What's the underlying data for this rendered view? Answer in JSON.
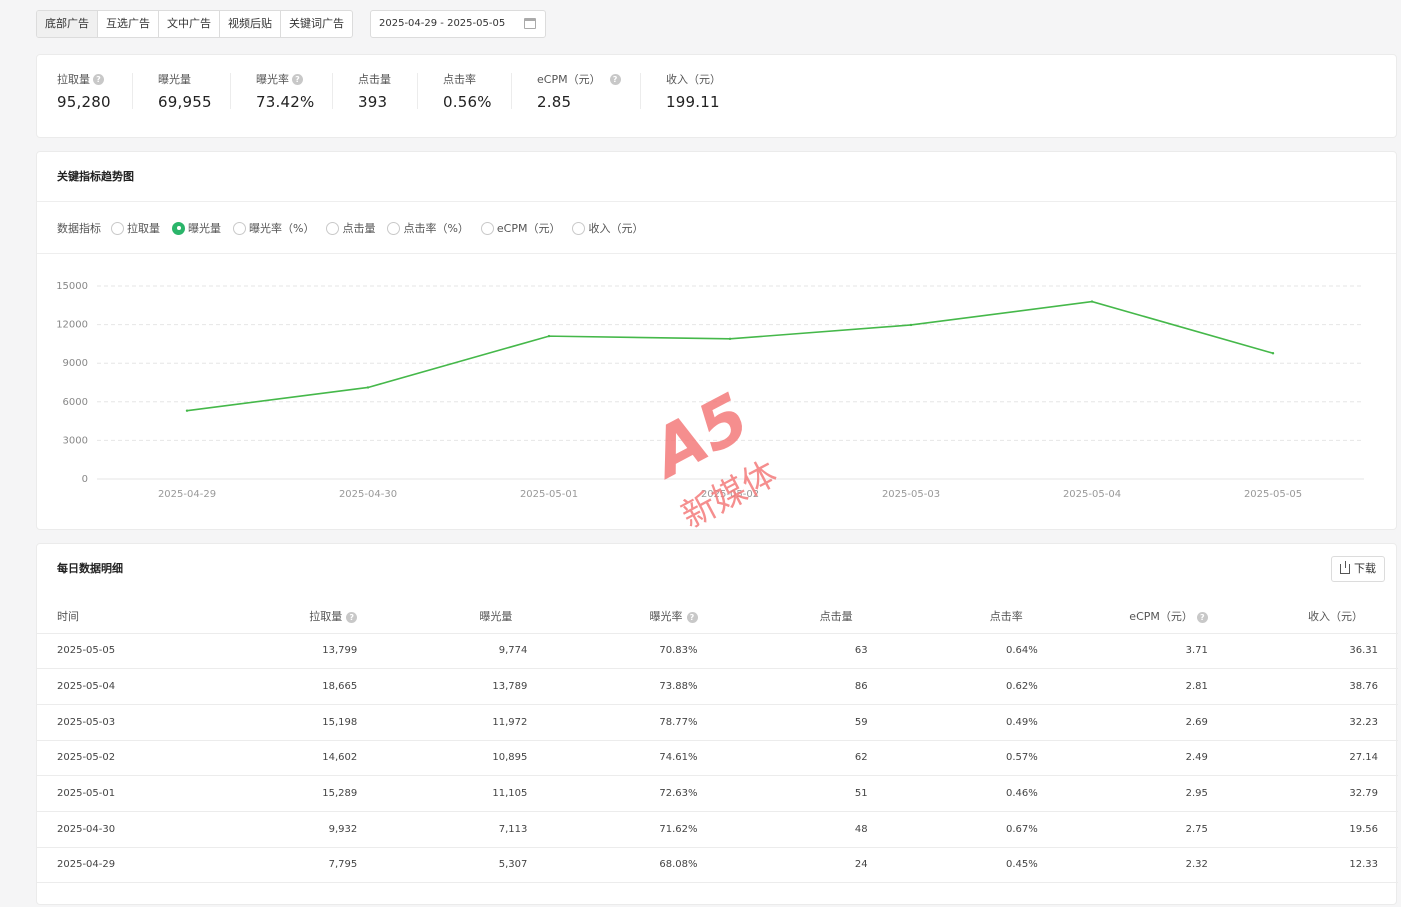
{
  "tabs": [
    "底部广告",
    "互选广告",
    "文中广告",
    "视频后贴",
    "关键词广告"
  ],
  "date_range": "2025-04-29 - 2025-05-05",
  "summary": [
    {
      "label": "拉取量",
      "value": "95,280",
      "help": true
    },
    {
      "label": "曝光量",
      "value": "69,955",
      "help": false
    },
    {
      "label": "曝光率",
      "value": "73.42%",
      "help": true
    },
    {
      "label": "点击量",
      "value": "393",
      "help": false
    },
    {
      "label": "点击率",
      "value": "0.56%",
      "help": false
    },
    {
      "label": "eCPM（元）",
      "value": "2.85",
      "help": true
    },
    {
      "label": "收入（元）",
      "value": "199.11",
      "help": false
    }
  ],
  "trend": {
    "title": "关键指标趋势图",
    "metric_label": "数据指标",
    "options": [
      "拉取量",
      "曝光量",
      "曝光率（%）",
      "点击量",
      "点击率（%）",
      "eCPM（元）",
      "收入（元）"
    ],
    "selected": "曝光量"
  },
  "chart_data": {
    "type": "line",
    "x": [
      "2025-04-29",
      "2025-04-30",
      "2025-05-01",
      "2025-05-02",
      "2025-05-03",
      "2025-05-04",
      "2025-05-05"
    ],
    "series": [
      {
        "values": [
          5307,
          7113,
          11105,
          10895,
          11972,
          13789,
          9774
        ],
        "color": "#45b84a"
      }
    ],
    "ylim": [
      0,
      15000
    ],
    "yticks": [
      0,
      3000,
      6000,
      9000,
      12000,
      15000
    ],
    "grid": true
  },
  "watermark": {
    "logo_text": "A5",
    "text": "新媒体",
    "color": "#f47b7b"
  },
  "detail": {
    "title": "每日数据明细",
    "download_label": "下载",
    "columns": [
      "时间",
      "拉取量",
      "曝光量",
      "曝光率",
      "点击量",
      "点击率",
      "eCPM（元）",
      "收入（元）"
    ],
    "help_columns": [
      1,
      3,
      6
    ],
    "rows": [
      [
        "2025-05-05",
        "13,799",
        "9,774",
        "70.83%",
        "63",
        "0.64%",
        "3.71",
        "36.31"
      ],
      [
        "2025-05-04",
        "18,665",
        "13,789",
        "73.88%",
        "86",
        "0.62%",
        "2.81",
        "38.76"
      ],
      [
        "2025-05-03",
        "15,198",
        "11,972",
        "78.77%",
        "59",
        "0.49%",
        "2.69",
        "32.23"
      ],
      [
        "2025-05-02",
        "14,602",
        "10,895",
        "74.61%",
        "62",
        "0.57%",
        "2.49",
        "27.14"
      ],
      [
        "2025-05-01",
        "15,289",
        "11,105",
        "72.63%",
        "51",
        "0.46%",
        "2.95",
        "32.79"
      ],
      [
        "2025-04-30",
        "9,932",
        "7,113",
        "71.62%",
        "48",
        "0.67%",
        "2.75",
        "19.56"
      ],
      [
        "2025-04-29",
        "7,795",
        "5,307",
        "68.08%",
        "24",
        "0.45%",
        "2.32",
        "12.33"
      ]
    ]
  }
}
